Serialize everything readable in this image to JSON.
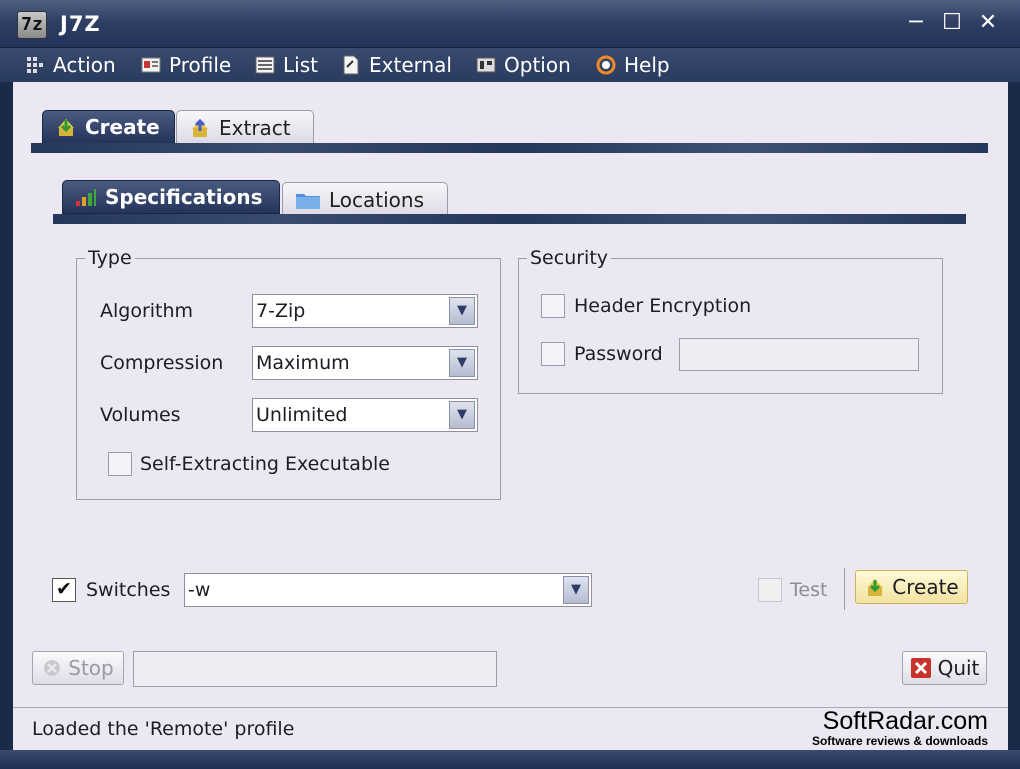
{
  "window": {
    "title": "J7Z",
    "app_icon_text": "7z"
  },
  "menu": [
    {
      "label": "Action",
      "icon": "action-icon"
    },
    {
      "label": "Profile",
      "icon": "profile-icon"
    },
    {
      "label": "List",
      "icon": "list-icon"
    },
    {
      "label": "External",
      "icon": "external-icon"
    },
    {
      "label": "Option",
      "icon": "option-icon"
    },
    {
      "label": "Help",
      "icon": "help-icon"
    }
  ],
  "main_tabs": [
    {
      "label": "Create",
      "active": true,
      "icon": "create-icon"
    },
    {
      "label": "Extract",
      "active": false,
      "icon": "extract-icon"
    }
  ],
  "sub_tabs": [
    {
      "label": "Specifications",
      "active": true,
      "icon": "signal-bars-icon"
    },
    {
      "label": "Locations",
      "active": false,
      "icon": "folder-icon"
    }
  ],
  "type_group": {
    "title": "Type",
    "algorithm_label": "Algorithm",
    "algorithm_value": "7-Zip",
    "compression_label": "Compression",
    "compression_value": "Maximum",
    "volumes_label": "Volumes",
    "volumes_value": "Unlimited",
    "sfx_label": "Self-Extracting Executable",
    "sfx_checked": false
  },
  "security_group": {
    "title": "Security",
    "header_encryption_label": "Header Encryption",
    "header_encryption_checked": false,
    "password_label": "Password",
    "password_checked": false,
    "password_value": ""
  },
  "switches": {
    "label": "Switches",
    "checked": true,
    "value": "-w"
  },
  "test": {
    "label": "Test",
    "checked": false,
    "enabled": false
  },
  "create_button": {
    "label": "Create"
  },
  "stop_button": {
    "label": "Stop",
    "enabled": false
  },
  "quit_button": {
    "label": "Quit"
  },
  "status": {
    "text": "Loaded the 'Remote' profile"
  },
  "watermark": {
    "name": "SoftRadar.com",
    "tagline": "Software reviews & downloads"
  },
  "colors": {
    "frame": "#2f4064",
    "client_bg": "#ebe8f2",
    "quit_icon": "#c8342b"
  }
}
